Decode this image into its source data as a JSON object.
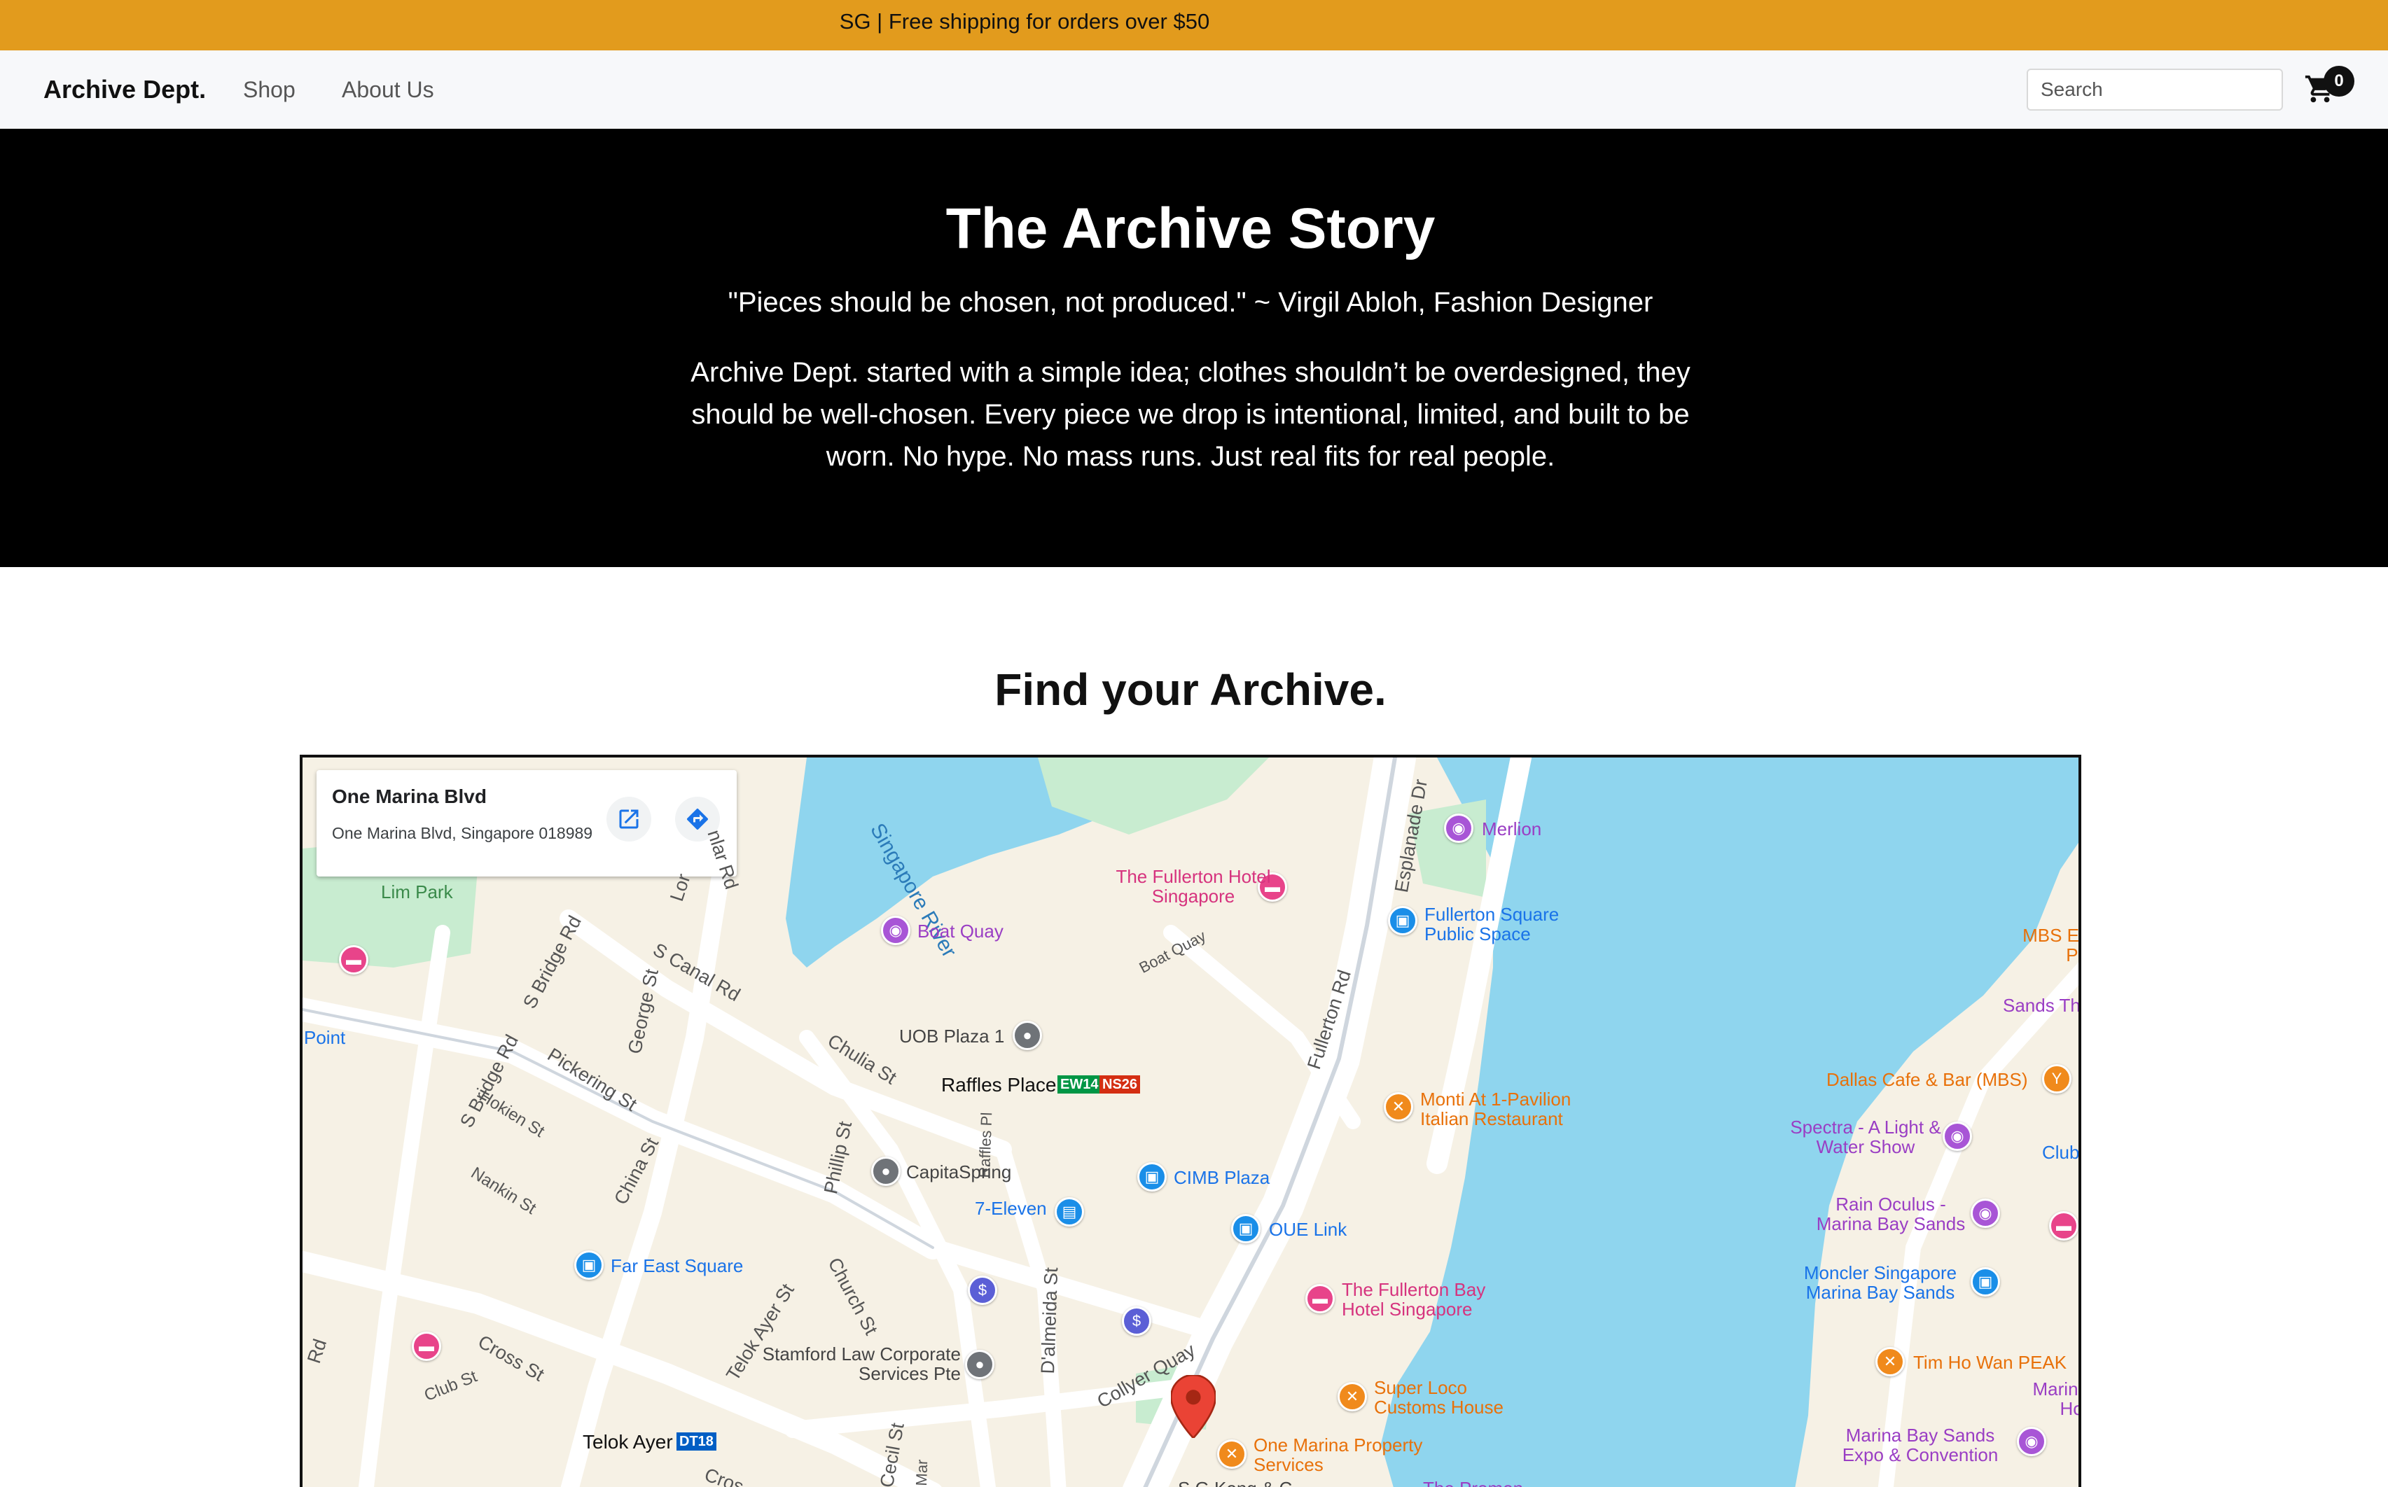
{
  "announcement": {
    "text": "SG  |  Free shipping for orders over $50"
  },
  "nav": {
    "brand": "Archive Dept.",
    "links": [
      "Shop",
      "About Us"
    ],
    "search_placeholder": "Search",
    "cart_count": "0"
  },
  "hero": {
    "title": "The Archive Story",
    "quote": "\"Pieces should be chosen, not produced.\" ~ Virgil Abloh, Fashion Designer",
    "body": "Archive Dept. started with a simple idea; clothes shouldn’t be overdesigned, they should be well-chosen. Every piece we drop is intentional, limited, and built to be worn. No hype. No mass runs. Just real fits for real people."
  },
  "find": {
    "title": "Find your Archive."
  },
  "map": {
    "info_card": {
      "title": "One Marina Blvd",
      "address": "One Marina Blvd, Singapore 018989"
    },
    "labels": {
      "singapore_river": "Singapore River",
      "lim_park": "Lim Park",
      "point": "Point",
      "boat_quay": "Boat Quay",
      "boat_quay_road": "Boat Quay",
      "fullerton_hotel": "The Fullerton Hotel Singapore",
      "merlion": "Merlion",
      "fullerton_square": "Fullerton Square Public Space",
      "mbs_ev": "MBS Ev Pu",
      "sands_th": "Sands Th",
      "dallas_cafe": "Dallas Cafe & Bar (MBS)",
      "spectra": "Spectra - A Light & Water Show",
      "club": "Club",
      "rain_oculus": "Rain Oculus - Marina Bay Sands",
      "moncler": "Moncler Singapore Marina Bay Sands",
      "tim_ho_wan": "Tim Ho Wan PEAK",
      "marina_hot": "Marina Hot",
      "mbs_expo": "Marina Bay Sands Expo & Convention",
      "uob_plaza": "UOB Plaza 1",
      "raffles_place": "Raffles Place",
      "ew14": "EW14",
      "ns26": "NS26",
      "monti": "Monti At 1-Pavilion Italian Restaurant",
      "capitaspring": "CapitaSpring",
      "cimb_plaza": "CIMB Plaza",
      "seven_eleven": "7-Eleven",
      "oue_link": "OUE Link",
      "far_east_square": "Far East Square",
      "fullerton_bay": "The Fullerton Bay Hotel Singapore",
      "stamford_law": "Stamford Law Corporate Services Pte",
      "super_loco": "Super Loco Customs House",
      "one_marina_prop": "One Marina Property Services",
      "telok_ayer": "Telok Ayer",
      "dt18": "DT18",
      "s_canal_rd": "S Canal Rd",
      "chulia_st": "Chulia St",
      "pickering_st": "Pickering St",
      "hokien_st": "Hokien St",
      "nankin_st": "Nankin St",
      "china_st": "China St",
      "phillip_st": "Phillip St",
      "raffles_pl": "Raffles Pl",
      "church_st": "Church St",
      "telok_ayer_st": "Telok Ayer St",
      "dalmeida_st": "D'almeida St",
      "collyer_quay": "Collyer Quay",
      "cross_st": "Cross St",
      "club_st": "Club St",
      "cecil_st": "Cecil St",
      "fullerton_rd": "Fullerton Rd",
      "esplanade_dr": "Esplanade Dr",
      "s_bridge_rd_1": "S Bridge Rd",
      "s_bridge_rd_2": "S Bridge Rd",
      "george_st": "George St",
      "lor": "Lor",
      "rd_1": "Rd",
      "rd_2": "Rd",
      "nlar": "nlar Rd",
      "cross_short": "Cros",
      "s_g_kong": "S G Kong & C",
      "the_promon": "The Promon",
      "mar": "Mar"
    }
  }
}
